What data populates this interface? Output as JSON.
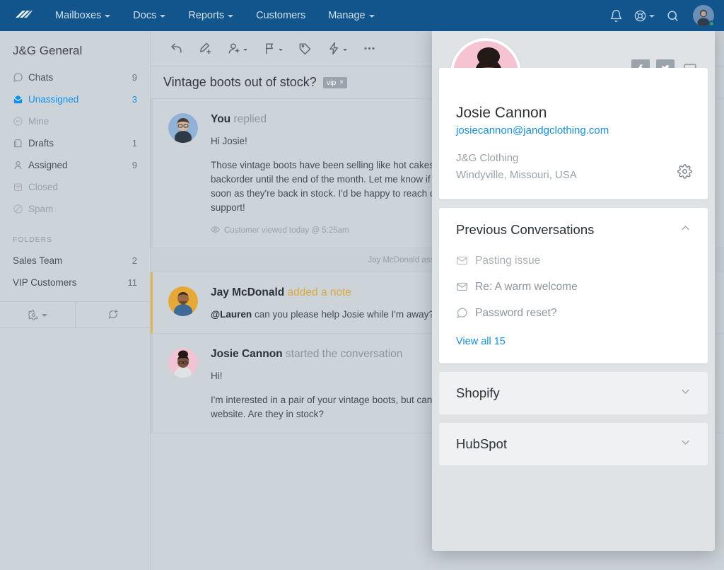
{
  "topnav": {
    "logo_icon": "helpscout-logo-icon",
    "items": [
      {
        "label": "Mailboxes",
        "caret": true
      },
      {
        "label": "Docs",
        "caret": true
      },
      {
        "label": "Reports",
        "caret": true
      },
      {
        "label": "Customers",
        "caret": false
      },
      {
        "label": "Manage",
        "caret": true
      }
    ],
    "right_icons": [
      "bell-icon",
      "lifering-icon",
      "search-icon",
      "avatar"
    ]
  },
  "sidebar": {
    "title": "J&G General",
    "items": [
      {
        "label": "Chats",
        "count": "9",
        "icon": "chat-bubble-icon",
        "state": "normal"
      },
      {
        "label": "Unassigned",
        "count": "3",
        "icon": "open-envelope-icon",
        "state": "active"
      },
      {
        "label": "Mine",
        "count": "",
        "icon": "hand-icon",
        "state": "muted"
      },
      {
        "label": "Drafts",
        "count": "1",
        "icon": "drafts-icon",
        "state": "normal"
      },
      {
        "label": "Assigned",
        "count": "9",
        "icon": "person-icon",
        "state": "normal"
      },
      {
        "label": "Closed",
        "count": "",
        "icon": "archive-icon",
        "state": "muted"
      },
      {
        "label": "Spam",
        "count": "",
        "icon": "ban-icon",
        "state": "muted"
      }
    ],
    "folders_header": "FOLDERS",
    "folders": [
      {
        "label": "Sales Team",
        "count": "2"
      },
      {
        "label": "VIP Customers",
        "count": "11"
      }
    ],
    "bottom": {
      "settings_icon": "gear-caret-icon",
      "new_icon": "new-conversation-icon"
    }
  },
  "toolbar": {
    "buttons": [
      {
        "name": "reply-button",
        "icon": "reply-arrow-icon",
        "caret": false
      },
      {
        "name": "add-note-button",
        "icon": "pen-plus-icon",
        "caret": false
      },
      {
        "name": "assign-button",
        "icon": "person-plus-icon",
        "caret": true
      },
      {
        "name": "status-button",
        "icon": "flag-icon",
        "caret": true
      },
      {
        "name": "tag-button",
        "icon": "tag-icon",
        "caret": false
      },
      {
        "name": "workflow-button",
        "icon": "lightning-bolt-icon",
        "caret": true
      },
      {
        "name": "more-button",
        "icon": "ellipsis-icon",
        "caret": false
      }
    ]
  },
  "conversation": {
    "subject": "Vintage boots out of stock?",
    "tag": {
      "label": "vip",
      "close": "×"
    },
    "messages": [
      {
        "type": "reply",
        "author": "You",
        "action": "replied",
        "avatar_color": "#8fb2d6",
        "paragraphs": [
          "Hi Josie!",
          "Those vintage boots have been selling like hot cakes(!) and\nbackorder until the end of the month. Let me know if you'd\nsoon as they're back in stock. I'd be happy to reach out. Tha\nsupport!"
        ],
        "meta": "Customer viewed today @ 5:25am",
        "meta_icon": "eye-icon"
      },
      {
        "type": "event",
        "text": "Jay McDonald assigned Lauren Green"
      },
      {
        "type": "note",
        "author": "Jay McDonald",
        "action": "added a note",
        "avatar_color": "#e7a935",
        "mention": "@Lauren",
        "paragraphs": [
          " can you please help Josie while I'm away? Would"
        ]
      },
      {
        "type": "message",
        "author": "Josie Cannon",
        "action": "started the conversation",
        "avatar_color": "#f2c4d3",
        "paragraphs": [
          "Hi!",
          "I'm interested in a pair of your vintage boots, but can't seem\nwebsite. Are they in stock?"
        ]
      }
    ]
  },
  "customer_panel": {
    "socials": [
      {
        "name": "facebook-icon",
        "label": "f"
      },
      {
        "name": "twitter-icon",
        "label": "t"
      },
      {
        "name": "website-icon",
        "label": "w"
      }
    ],
    "name": "Josie Cannon",
    "email": "josiecannon@jandgclothing.com",
    "company": "J&G Clothing",
    "location": "Windyville, Missouri, USA",
    "gear_icon": "gear-icon",
    "previous": {
      "title": "Previous Conversations",
      "collapse_icon": "chevron-up-icon",
      "items": [
        {
          "label": "Pasting issue",
          "icon": "envelope-icon",
          "read": true
        },
        {
          "label": "Re: A warm welcome",
          "icon": "envelope-icon",
          "read": false
        },
        {
          "label": "Password reset?",
          "icon": "chat-bubble-icon",
          "read": false
        }
      ],
      "view_all": "View all 15"
    },
    "apps": [
      {
        "name": "Shopify",
        "icon": "chevron-down-icon"
      },
      {
        "name": "HubSpot",
        "icon": "chevron-down-icon"
      }
    ]
  },
  "colors": {
    "nav_blue": "#12558d",
    "accent_blue": "#1292ee",
    "note_amber": "#e0b64d",
    "sidebar_gray": "#ccd3d9",
    "panel_gray": "#dfe3e6"
  }
}
